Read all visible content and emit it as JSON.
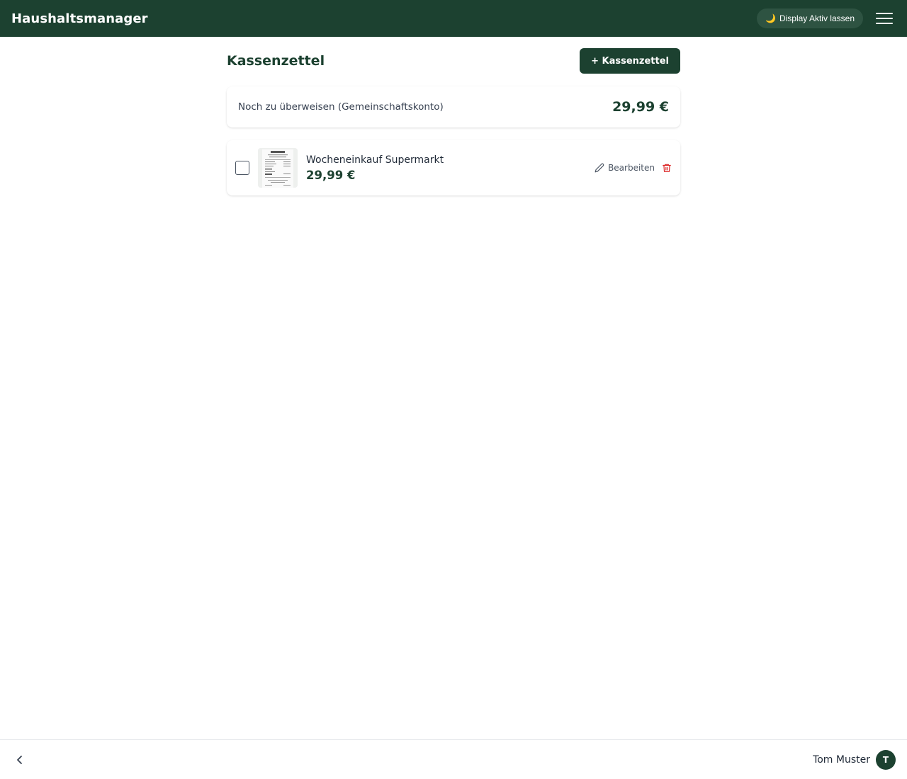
{
  "app": {
    "title": "Haushaltsmanager"
  },
  "topbar": {
    "display_toggle_label": "Display Aktiv lassen",
    "display_toggle_icon": "moon-icon",
    "menu_icon": "hamburger-menu-icon"
  },
  "page": {
    "title": "Kassenzettel",
    "add_button_label": "+ Kassenzettel"
  },
  "summary": {
    "label": "Noch zu überweisen (Gemeinschaftskonto)",
    "amount": "29,99 €"
  },
  "receipts": [
    {
      "title": "Wocheneinkauf Supermarkt",
      "amount": "29,99 €",
      "checked": false,
      "edit_label": "Bearbeiten",
      "edit_icon": "pencil-icon",
      "delete_icon": "trash-icon"
    }
  ],
  "bottombar": {
    "back_icon": "chevron-left-icon",
    "user_name": "Tom Muster",
    "avatar_initial": "T"
  },
  "colors": {
    "primary": "#1c4130",
    "danger": "#dc2626",
    "moon": "#f4c542"
  }
}
